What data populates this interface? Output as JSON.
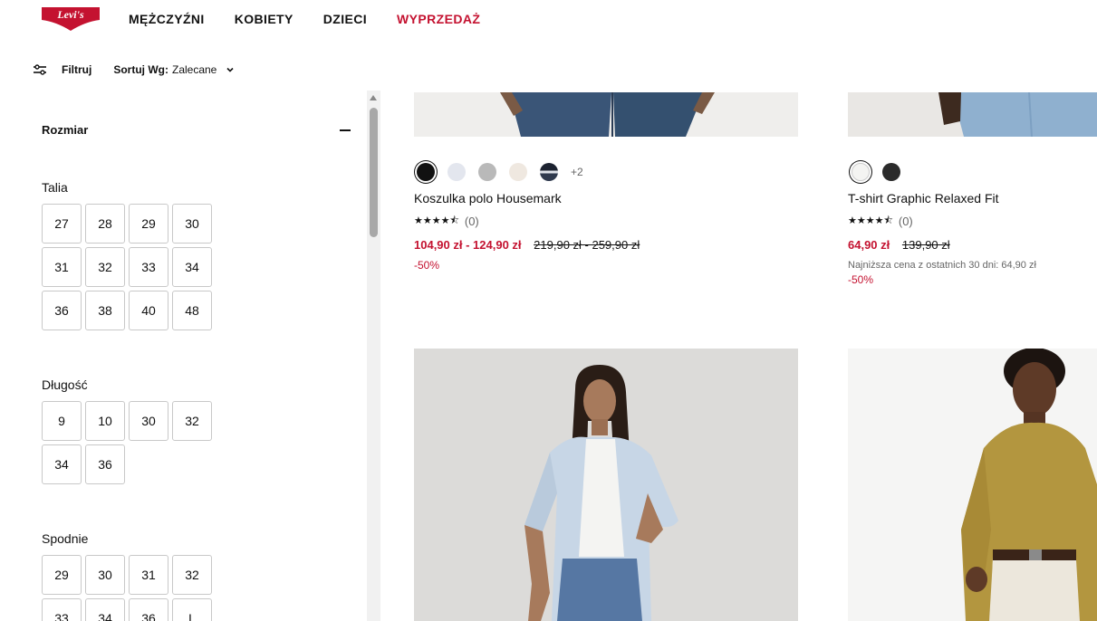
{
  "header": {
    "logo_text": "Levi's",
    "nav": [
      "MĘŻCZYŹNI",
      "KOBIETY",
      "DZIECI",
      "WYPRZEDAŻ"
    ]
  },
  "toolbar": {
    "filter_label": "Filtruj",
    "sort_label": "Sortuj Wg:",
    "sort_value": "Zalecane"
  },
  "sidebar": {
    "section_title": "Rozmiar",
    "talia": {
      "title": "Talia",
      "sizes": [
        "27",
        "28",
        "29",
        "30",
        "31",
        "32",
        "33",
        "34",
        "36",
        "38",
        "40",
        "48"
      ]
    },
    "dlugosc": {
      "title": "Długość",
      "sizes": [
        "9",
        "10",
        "30",
        "32",
        "34",
        "36"
      ]
    },
    "spodnie": {
      "title": "Spodnie",
      "sizes": [
        "29",
        "30",
        "31",
        "32",
        "33",
        "34",
        "36",
        "L"
      ]
    }
  },
  "products": [
    {
      "name": "Koszulka polo Housemark",
      "swatch_colors": [
        "#111111",
        "#e3e6ee",
        "#b9b9b9",
        "#efe8e0",
        "#2f3a4e"
      ],
      "more_colors": "+2",
      "rating_stars": "★★★★⯪",
      "rating_count": "(0)",
      "price": "104,90 zł - 124,90 zł",
      "old_price": "219,90 zł - 259,90 zł",
      "discount": "-50%"
    },
    {
      "name": "T-shirt Graphic Relaxed Fit",
      "swatch_colors": [
        "#f4f4f2",
        "#2b2b2b"
      ],
      "rating_stars": "★★★★⯪",
      "rating_count": "(0)",
      "price": "64,90 zł",
      "old_price": "139,90 zł",
      "lowest_price_note": "Najniższa cena z ostatnich 30 dni: 64,90 zł",
      "discount": "-50%"
    }
  ],
  "colors": {
    "sale": "#c41230",
    "brand": "#c41230"
  }
}
